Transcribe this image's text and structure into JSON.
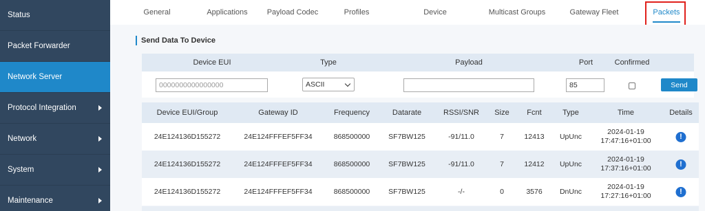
{
  "sidebar": {
    "items": [
      {
        "label": "Status",
        "active": false,
        "has_arrow": false
      },
      {
        "label": "Packet Forwarder",
        "active": false,
        "has_arrow": false
      },
      {
        "label": "Network Server",
        "active": true,
        "has_arrow": false
      },
      {
        "label": "Protocol Integration",
        "active": false,
        "has_arrow": true
      },
      {
        "label": "Network",
        "active": false,
        "has_arrow": true
      },
      {
        "label": "System",
        "active": false,
        "has_arrow": true
      },
      {
        "label": "Maintenance",
        "active": false,
        "has_arrow": true
      }
    ]
  },
  "tabs": [
    {
      "label": "General"
    },
    {
      "label": "Applications"
    },
    {
      "label": "Payload Codec"
    },
    {
      "label": "Profiles"
    },
    {
      "label": "Device"
    },
    {
      "label": "Multicast Groups"
    },
    {
      "label": "Gateway Fleet"
    },
    {
      "label": "Packets",
      "active": true
    }
  ],
  "send": {
    "title": "Send Data To Device",
    "headers": {
      "device_eui": "Device EUI",
      "type": "Type",
      "payload": "Payload",
      "port": "Port",
      "confirmed": "Confirmed"
    },
    "device_eui_placeholder": "0000000000000000",
    "type_value": "ASCII",
    "payload_value": "",
    "port_value": "85",
    "confirmed": false,
    "button_label": "Send"
  },
  "packets": {
    "headers": {
      "eui": "Device EUI/Group",
      "gateway": "Gateway ID",
      "frequency": "Frequency",
      "datarate": "Datarate",
      "rssi": "RSSI/SNR",
      "size": "Size",
      "fcnt": "Fcnt",
      "type": "Type",
      "time": "Time",
      "details": "Details"
    },
    "rows": [
      {
        "eui": "24E124136D155272",
        "gateway": "24E124FFFEF5FF34",
        "frequency": "868500000",
        "datarate": "SF7BW125",
        "rssi": "-91/11.0",
        "size": "7",
        "fcnt": "12413",
        "type": "UpUnc",
        "date": "2024-01-19",
        "time": "17:47:16+01:00"
      },
      {
        "eui": "24E124136D155272",
        "gateway": "24E124FFFEF5FF34",
        "frequency": "868500000",
        "datarate": "SF7BW125",
        "rssi": "-91/11.0",
        "size": "7",
        "fcnt": "12412",
        "type": "UpUnc",
        "date": "2024-01-19",
        "time": "17:37:16+01:00"
      },
      {
        "eui": "24E124136D155272",
        "gateway": "24E124FFFEF5FF34",
        "frequency": "868500000",
        "datarate": "SF7BW125",
        "rssi": "-/-",
        "size": "0",
        "fcnt": "3576",
        "type": "DnUnc",
        "date": "2024-01-19",
        "time": "17:27:16+01:00"
      }
    ]
  },
  "colors": {
    "sidebar_bg": "#31475f",
    "accent": "#1f88c9",
    "highlight_box": "#e0201b",
    "info_icon": "#1f6fd0"
  },
  "icons": {
    "submenu_arrow": "chevron-right-icon",
    "details": "info-icon",
    "select_arrow": "chevron-down-icon"
  }
}
